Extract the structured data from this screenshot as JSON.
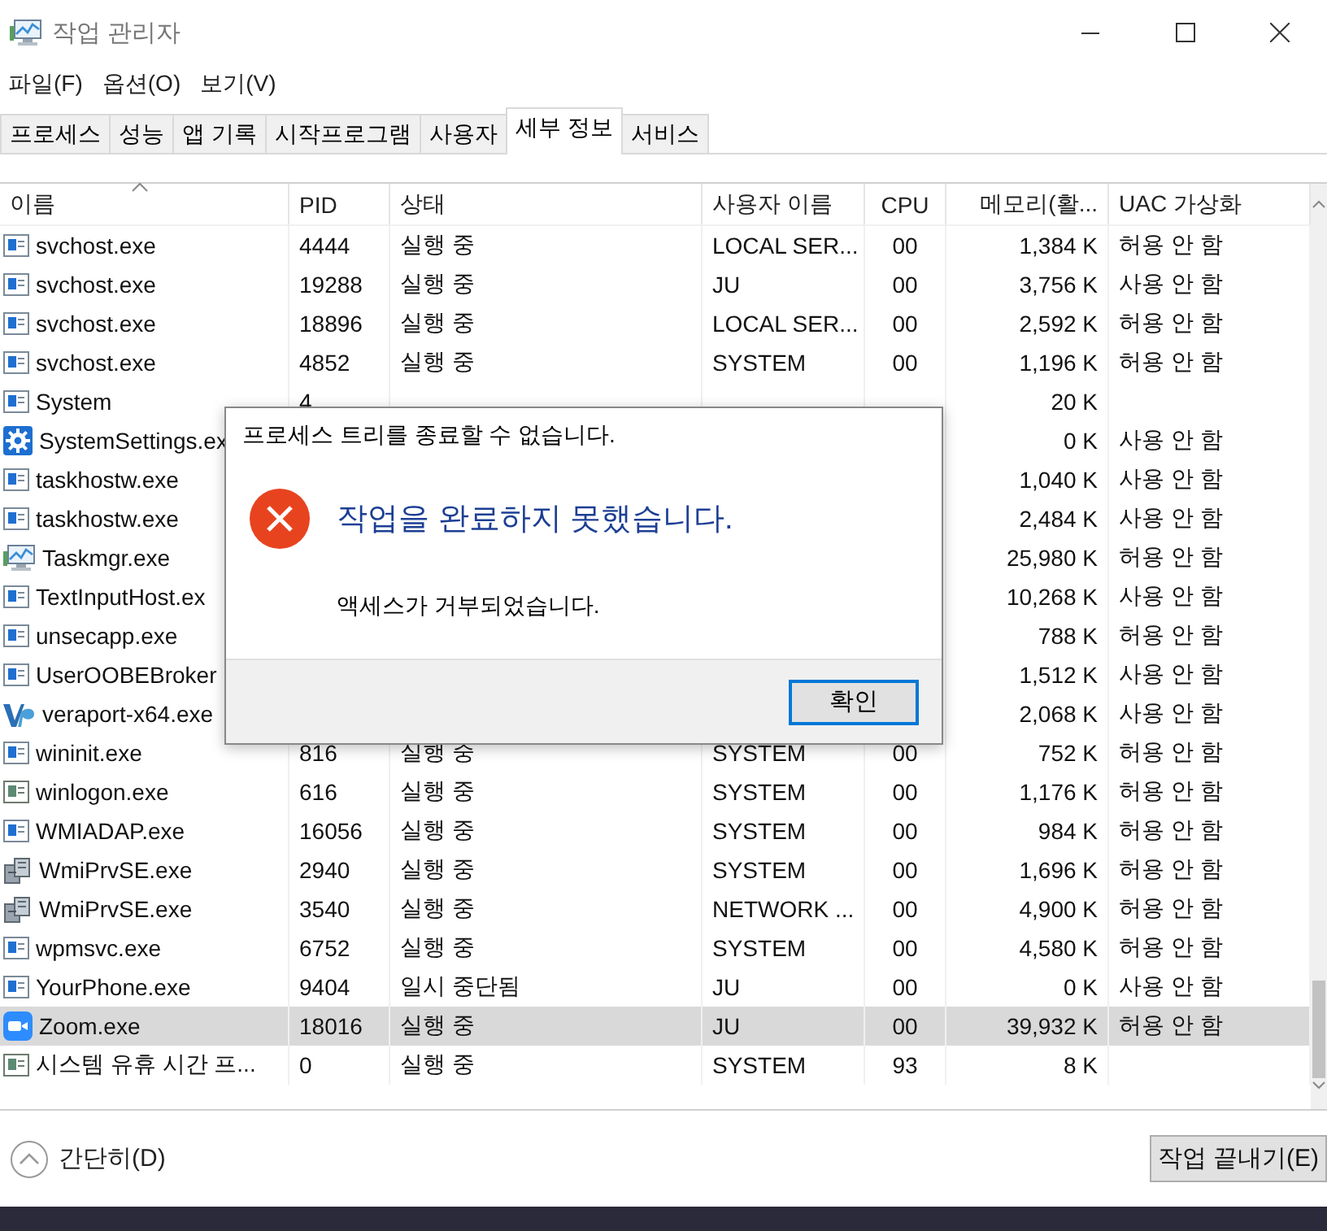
{
  "window": {
    "title": "작업 관리자"
  },
  "menu": [
    "파일(F)",
    "옵션(O)",
    "보기(V)"
  ],
  "tabs": [
    {
      "label": "프로세스",
      "selected": false
    },
    {
      "label": "성능",
      "selected": false
    },
    {
      "label": "앱 기록",
      "selected": false
    },
    {
      "label": "시작프로그램",
      "selected": false
    },
    {
      "label": "사용자",
      "selected": false
    },
    {
      "label": "세부 정보",
      "selected": true
    },
    {
      "label": "서비스",
      "selected": false
    }
  ],
  "table": {
    "columns": [
      {
        "label": "이름",
        "sorted": true
      },
      {
        "label": "PID",
        "sorted": false
      },
      {
        "label": "상태",
        "sorted": false
      },
      {
        "label": "사용자 이름",
        "sorted": false
      },
      {
        "label": "CPU",
        "sorted": false
      },
      {
        "label": "메모리(활...",
        "sorted": false
      },
      {
        "label": "UAC 가상화",
        "sorted": false
      }
    ],
    "rows": [
      {
        "kind": "service",
        "cells": [
          "svchost.exe",
          "4444",
          "실행 중",
          "LOCAL SER...",
          "00",
          "1,384 K",
          "허용 안 함"
        ],
        "selected": false
      },
      {
        "kind": "service",
        "cells": [
          "svchost.exe",
          "19288",
          "실행 중",
          "JU",
          "00",
          "3,756 K",
          "사용 안 함"
        ],
        "selected": false
      },
      {
        "kind": "service",
        "cells": [
          "svchost.exe",
          "18896",
          "실행 중",
          "LOCAL SER...",
          "00",
          "2,592 K",
          "허용 안 함"
        ],
        "selected": false
      },
      {
        "kind": "service",
        "cells": [
          "svchost.exe",
          "4852",
          "실행 중",
          "SYSTEM",
          "00",
          "1,196 K",
          "허용 안 함"
        ],
        "selected": false
      },
      {
        "kind": "service",
        "cells": [
          "System",
          "4",
          null,
          null,
          null,
          "20 K",
          null
        ],
        "selected": false
      },
      {
        "kind": "gear",
        "cells": [
          "SystemSettings.ex",
          null,
          null,
          null,
          null,
          "0 K",
          "사용 안 함"
        ],
        "selected": false
      },
      {
        "kind": "service",
        "cells": [
          "taskhostw.exe",
          null,
          null,
          null,
          null,
          "1,040 K",
          "사용 안 함"
        ],
        "selected": false
      },
      {
        "kind": "service",
        "cells": [
          "taskhostw.exe",
          null,
          null,
          null,
          null,
          "2,484 K",
          "사용 안 함"
        ],
        "selected": false
      },
      {
        "kind": "monitor",
        "cells": [
          "Taskmgr.exe",
          null,
          null,
          null,
          null,
          "25,980 K",
          "허용 안 함"
        ],
        "selected": false
      },
      {
        "kind": "service",
        "cells": [
          "TextInputHost.ex",
          null,
          null,
          null,
          null,
          "10,268 K",
          "사용 안 함"
        ],
        "selected": false
      },
      {
        "kind": "service",
        "cells": [
          "unsecapp.exe",
          null,
          null,
          null,
          null,
          "788 K",
          "허용 안 함"
        ],
        "selected": false
      },
      {
        "kind": "service",
        "cells": [
          "UserOOBEBroker",
          null,
          null,
          null,
          null,
          "1,512 K",
          "사용 안 함"
        ],
        "selected": false
      },
      {
        "kind": "swoosh",
        "cells": [
          "veraport-x64.exe",
          null,
          null,
          null,
          null,
          "2,068 K",
          "사용 안 함"
        ],
        "selected": false
      },
      {
        "kind": "service",
        "cells": [
          "wininit.exe",
          "816",
          "실행 중",
          "SYSTEM",
          "00",
          "752 K",
          "허용 안 함"
        ],
        "selected": false
      },
      {
        "kind": "window",
        "cells": [
          "winlogon.exe",
          "616",
          "실행 중",
          "SYSTEM",
          "00",
          "1,176 K",
          "허용 안 함"
        ],
        "selected": false
      },
      {
        "kind": "service",
        "cells": [
          "WMIADAP.exe",
          "16056",
          "실행 중",
          "SYSTEM",
          "00",
          "984 K",
          "허용 안 함"
        ],
        "selected": false
      },
      {
        "kind": "server",
        "cells": [
          "WmiPrvSE.exe",
          "2940",
          "실행 중",
          "SYSTEM",
          "00",
          "1,696 K",
          "허용 안 함"
        ],
        "selected": false
      },
      {
        "kind": "server",
        "cells": [
          "WmiPrvSE.exe",
          "3540",
          "실행 중",
          "NETWORK ...",
          "00",
          "4,900 K",
          "허용 안 함"
        ],
        "selected": false
      },
      {
        "kind": "service",
        "cells": [
          "wpmsvc.exe",
          "6752",
          "실행 중",
          "SYSTEM",
          "00",
          "4,580 K",
          "허용 안 함"
        ],
        "selected": false
      },
      {
        "kind": "service",
        "cells": [
          "YourPhone.exe",
          "9404",
          "일시 중단됨",
          "JU",
          "00",
          "0 K",
          "사용 안 함"
        ],
        "selected": false
      },
      {
        "kind": "camera",
        "cells": [
          "Zoom.exe",
          "18016",
          "실행 중",
          "JU",
          "00",
          "39,932 K",
          "허용 안 함"
        ],
        "selected": true
      },
      {
        "kind": "window",
        "cells": [
          "시스템 유휴 시간 프...",
          "0",
          "실행 중",
          "SYSTEM",
          "93",
          "8 K",
          null
        ],
        "selected": false
      }
    ]
  },
  "footer": {
    "collapse": "간단히(D)",
    "end_task": "작업 끝내기(E)"
  },
  "dialog": {
    "title": "프로세스 트리를 종료할 수 없습니다.",
    "heading": "작업을 완료하지 못했습니다.",
    "message": "액세스가 거부되었습니다.",
    "button": "확인"
  }
}
